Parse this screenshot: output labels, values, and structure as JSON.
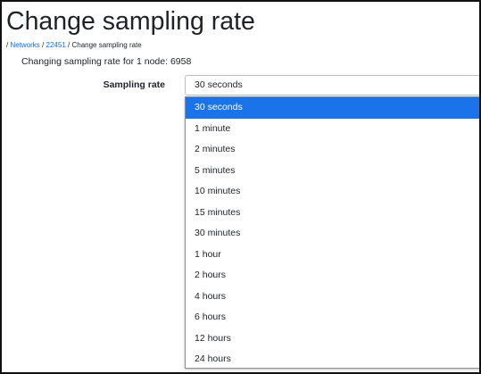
{
  "page": {
    "title": "Change sampling rate",
    "breadcrumb": {
      "separator": "/",
      "networks": "Networks",
      "network_id": "22451",
      "current": "Change sampling rate"
    },
    "subtext": "Changing sampling rate for 1 node: 6958"
  },
  "form": {
    "sampling_label": "Sampling rate",
    "selected_value": "30 seconds",
    "chevron_icon": "chevron-down-icon"
  },
  "dropdown": {
    "options": [
      "30 seconds",
      "1 minute",
      "2 minutes",
      "5 minutes",
      "10 minutes",
      "15 minutes",
      "30 minutes",
      "1 hour",
      "2 hours",
      "4 hours",
      "6 hours",
      "12 hours",
      "24 hours"
    ],
    "selected_index": 0
  },
  "colors": {
    "selected_bg": "#1a73e8",
    "link": "#0d6efd"
  }
}
